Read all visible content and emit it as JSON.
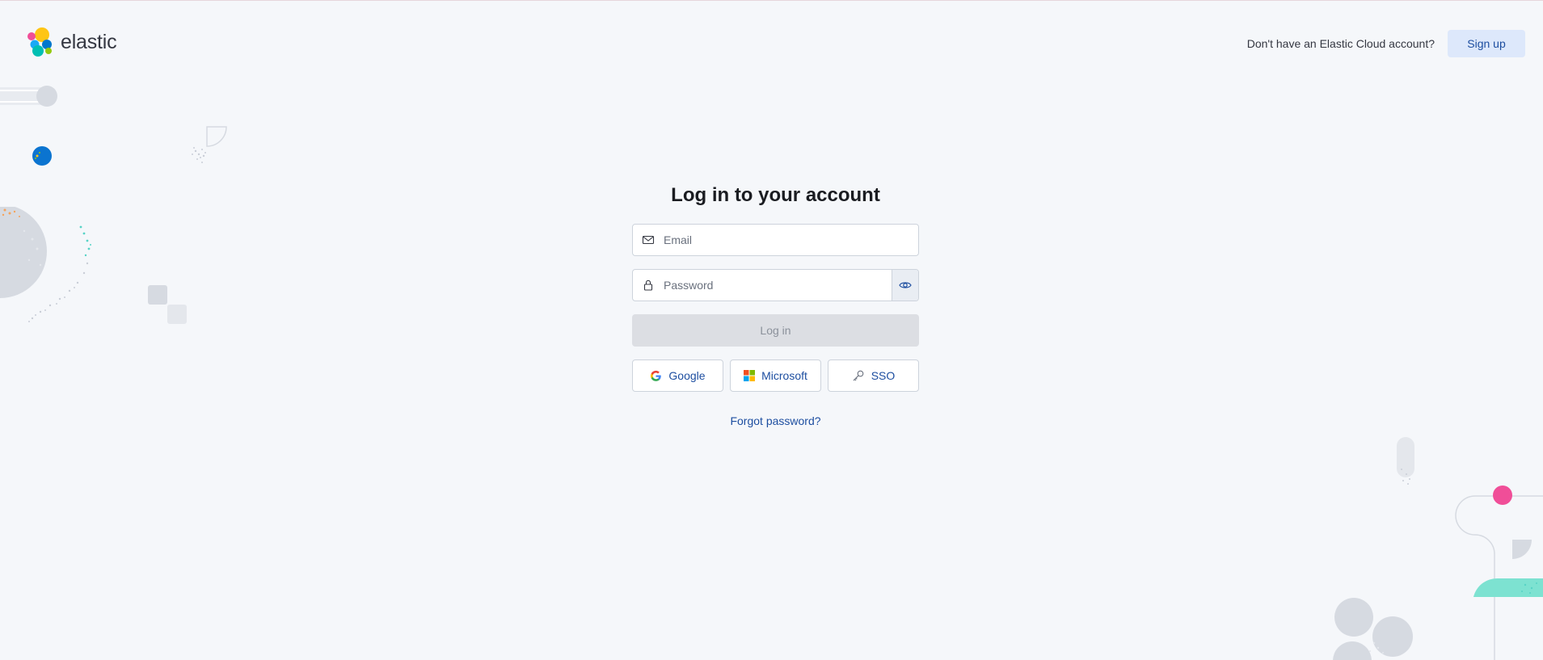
{
  "brand": {
    "name": "elastic",
    "colors": [
      "#fec514",
      "#f04e98",
      "#00bfb3",
      "#1ba9f5",
      "#0077cc",
      "#93c90e"
    ]
  },
  "header": {
    "prompt_text": "Don't have an Elastic Cloud account?",
    "signup_label": "Sign up"
  },
  "login": {
    "title": "Log in to your account",
    "email": {
      "placeholder": "Email",
      "value": "",
      "icon": "mail-icon"
    },
    "password": {
      "placeholder": "Password",
      "value": "",
      "icon": "lock-icon",
      "toggle_icon": "eye-icon"
    },
    "submit_label": "Log in",
    "social": [
      {
        "label": "Google",
        "icon": "google-icon"
      },
      {
        "label": "Microsoft",
        "icon": "microsoft-icon"
      },
      {
        "label": "SSO",
        "icon": "key-icon"
      }
    ],
    "forgot_label": "Forgot password?"
  },
  "colors": {
    "background": "#f5f7fa",
    "link": "#1d4ea0",
    "signup_bg": "#dde8fb",
    "disabled_button": "#dcdee3"
  }
}
